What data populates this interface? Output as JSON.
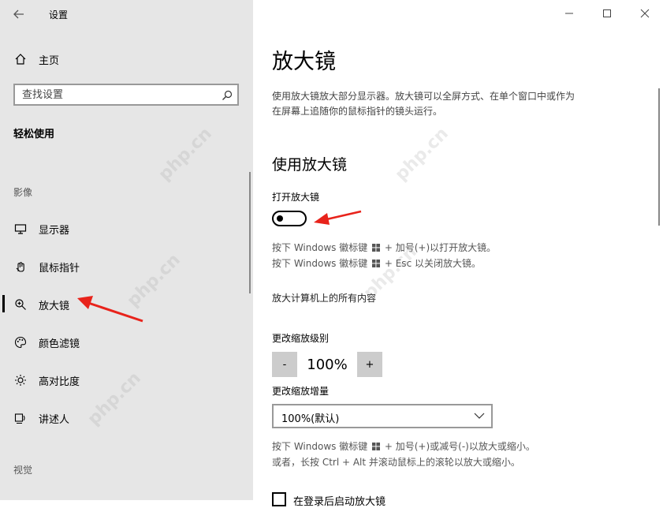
{
  "app": {
    "title": "设置"
  },
  "sidebar": {
    "home_label": "主页",
    "search_placeholder": "查找设置",
    "category": "轻松使用",
    "section_vision": "影像",
    "items": [
      {
        "label": "显示器",
        "icon": "monitor-icon"
      },
      {
        "label": "鼠标指针",
        "icon": "mouse-pointer-icon"
      },
      {
        "label": "放大镜",
        "icon": "magnifier-icon",
        "selected": true
      },
      {
        "label": "颜色滤镜",
        "icon": "palette-icon"
      },
      {
        "label": "高对比度",
        "icon": "brightness-icon"
      },
      {
        "label": "讲述人",
        "icon": "narrator-icon"
      }
    ],
    "section_hearing": "视觉"
  },
  "main": {
    "title": "放大镜",
    "description_line1": "使用放大镜放大部分显示器。放大镜可以全屏方式、在单个窗口中或作为",
    "description_line2": "在屏幕上追随你的鼠标指针的镜头运行。",
    "section_title": "使用放大镜",
    "toggle_label": "打开放大镜",
    "toggle_on": false,
    "hint_open_pre": "按下 Windows 徽标键",
    "hint_open_post": "+ 加号(+)以打开放大镜。",
    "hint_close_pre": "按下 Windows 徽标键",
    "hint_close_post": "+ Esc 以关闭放大镜。",
    "magnify_all": "放大计算机上的所有内容",
    "zoom_level_label": "更改缩放级别",
    "zoom_minus": "-",
    "zoom_value": "100%",
    "zoom_plus": "+",
    "increment_label": "更改缩放增量",
    "increment_value": "100%(默认)",
    "hint_zoom_pre": "按下 Windows 徽标键",
    "hint_zoom_post": "+ 加号(+)或减号(-)以放大或缩小。",
    "hint_scroll": "或者，长按 Ctrl + Alt 并滚动鼠标上的滚轮以放大或缩小。",
    "checkbox_label": "在登录后启动放大镜"
  },
  "colors": {
    "sidebar_bg": "#e6e6e6",
    "annotation_red": "#e8231b"
  },
  "watermark": "php.cn"
}
